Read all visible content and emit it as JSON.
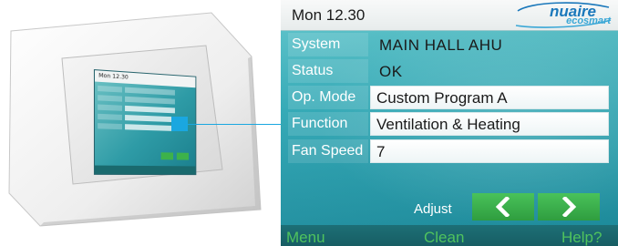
{
  "header": {
    "date_time": "Mon 12.30",
    "logo_brand": "nuaire",
    "logo_sub": "ecosmart"
  },
  "rows": [
    {
      "label": "System",
      "value": "MAIN HALL AHU"
    },
    {
      "label": "Status",
      "value": "OK"
    },
    {
      "label": "Op. Mode",
      "value": "Custom Program A"
    },
    {
      "label": "Function",
      "value": "Ventilation & Heating"
    },
    {
      "label": "Fan Speed",
      "value": "7"
    }
  ],
  "adjust": {
    "label": "Adjust",
    "prev_icon": "chevron-left-icon",
    "next_icon": "chevron-right-icon"
  },
  "bottom_bar": {
    "menu": "Menu",
    "clean": "Clean",
    "help": "Help?"
  },
  "colors": {
    "screen_teal": "#2aa8b6",
    "button_green": "#3db24a",
    "highlight_blue": "#1aa7e0",
    "brand_blue": "#1b78bb"
  }
}
